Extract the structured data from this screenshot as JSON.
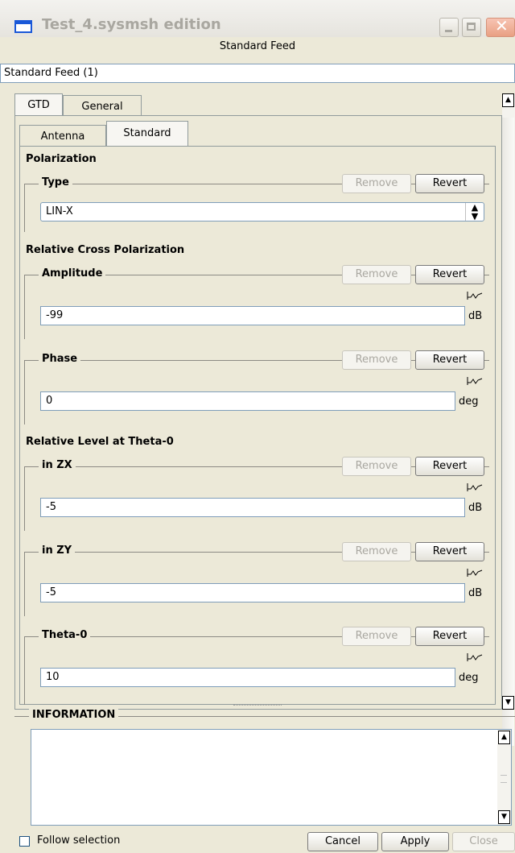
{
  "window": {
    "title": "Test_4.sysmsh edition"
  },
  "header": {
    "feed_title": "Standard Feed",
    "feed_name": "Standard Feed (1)"
  },
  "tabs": {
    "outer": [
      "GTD",
      "General"
    ],
    "inner": [
      "Antenna",
      "Standard"
    ]
  },
  "common": {
    "remove_label": "Remove",
    "revert_label": "Revert"
  },
  "polarization": {
    "section": "Polarization",
    "type_label": "Type",
    "type_value": "LIN-X"
  },
  "cross_pol": {
    "section": "Relative Cross Polarization",
    "amplitude": {
      "label": "Amplitude",
      "value": "-99",
      "unit": "dB"
    },
    "phase": {
      "label": "Phase",
      "value": "0",
      "unit": "deg"
    }
  },
  "level": {
    "section": "Relative Level at Theta-0",
    "zx": {
      "label": "in ZX",
      "value": "-5",
      "unit": "dB"
    },
    "zy": {
      "label": "in ZY",
      "value": "-5",
      "unit": "dB"
    },
    "theta0": {
      "label": "Theta-0",
      "value": "10",
      "unit": "deg"
    }
  },
  "information": {
    "label": "INFORMATION",
    "text": ""
  },
  "footer": {
    "follow_label": "Follow selection",
    "cancel_label": "Cancel",
    "apply_label": "Apply",
    "close_label": "Close"
  }
}
